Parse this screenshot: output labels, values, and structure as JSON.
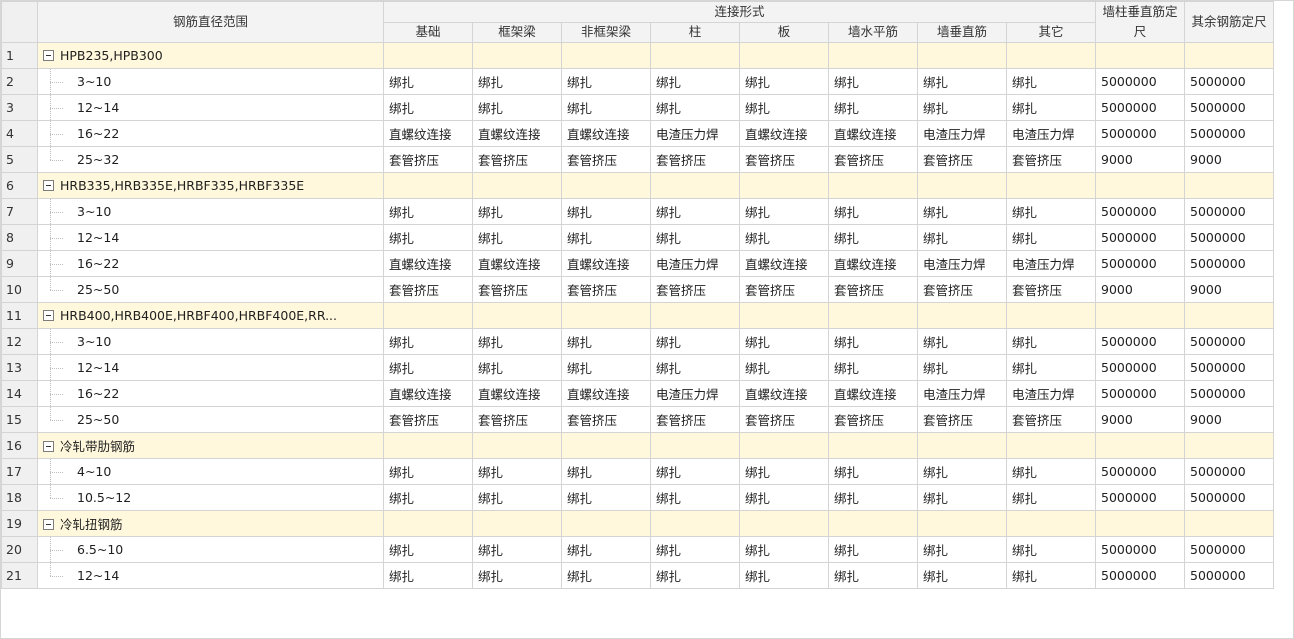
{
  "header": {
    "range_label": "钢筋直径范围",
    "group_label": "连接形式",
    "sub_cols": [
      "基础",
      "框架梁",
      "非框架梁",
      "柱",
      "板",
      "墙水平筋",
      "墙垂直筋",
      "其它"
    ],
    "wall_fixed_label": "墙柱垂直筋定尺",
    "other_fixed_label": "其余钢筋定尺"
  },
  "rows": [
    {
      "num": "1",
      "type": "group",
      "label": "HPB235,HPB300",
      "cells": [
        "",
        "",
        "",
        "",
        "",
        "",
        "",
        "",
        "",
        ""
      ]
    },
    {
      "num": "2",
      "type": "child",
      "label": "3~10",
      "cells": [
        "绑扎",
        "绑扎",
        "绑扎",
        "绑扎",
        "绑扎",
        "绑扎",
        "绑扎",
        "绑扎",
        "5000000",
        "5000000"
      ]
    },
    {
      "num": "3",
      "type": "child",
      "label": "12~14",
      "cells": [
        "绑扎",
        "绑扎",
        "绑扎",
        "绑扎",
        "绑扎",
        "绑扎",
        "绑扎",
        "绑扎",
        "5000000",
        "5000000"
      ]
    },
    {
      "num": "4",
      "type": "child",
      "label": "16~22",
      "cells": [
        "直螺纹连接",
        "直螺纹连接",
        "直螺纹连接",
        "电渣压力焊",
        "直螺纹连接",
        "直螺纹连接",
        "电渣压力焊",
        "电渣压力焊",
        "5000000",
        "5000000"
      ]
    },
    {
      "num": "5",
      "type": "child",
      "last": true,
      "label": "25~32",
      "cells": [
        "套管挤压",
        "套管挤压",
        "套管挤压",
        "套管挤压",
        "套管挤压",
        "套管挤压",
        "套管挤压",
        "套管挤压",
        "9000",
        "9000"
      ]
    },
    {
      "num": "6",
      "type": "group",
      "label": "HRB335,HRB335E,HRBF335,HRBF335E",
      "cells": [
        "",
        "",
        "",
        "",
        "",
        "",
        "",
        "",
        "",
        ""
      ]
    },
    {
      "num": "7",
      "type": "child",
      "label": "3~10",
      "cells": [
        "绑扎",
        "绑扎",
        "绑扎",
        "绑扎",
        "绑扎",
        "绑扎",
        "绑扎",
        "绑扎",
        "5000000",
        "5000000"
      ]
    },
    {
      "num": "8",
      "type": "child",
      "label": "12~14",
      "cells": [
        "绑扎",
        "绑扎",
        "绑扎",
        "绑扎",
        "绑扎",
        "绑扎",
        "绑扎",
        "绑扎",
        "5000000",
        "5000000"
      ]
    },
    {
      "num": "9",
      "type": "child",
      "label": "16~22",
      "cells": [
        "直螺纹连接",
        "直螺纹连接",
        "直螺纹连接",
        "电渣压力焊",
        "直螺纹连接",
        "直螺纹连接",
        "电渣压力焊",
        "电渣压力焊",
        "5000000",
        "5000000"
      ]
    },
    {
      "num": "10",
      "type": "child",
      "last": true,
      "label": "25~50",
      "cells": [
        "套管挤压",
        "套管挤压",
        "套管挤压",
        "套管挤压",
        "套管挤压",
        "套管挤压",
        "套管挤压",
        "套管挤压",
        "9000",
        "9000"
      ]
    },
    {
      "num": "11",
      "type": "group",
      "label": "HRB400,HRB400E,HRBF400,HRBF400E,RR...",
      "cells": [
        "",
        "",
        "",
        "",
        "",
        "",
        "",
        "",
        "",
        ""
      ]
    },
    {
      "num": "12",
      "type": "child",
      "label": "3~10",
      "cells": [
        "绑扎",
        "绑扎",
        "绑扎",
        "绑扎",
        "绑扎",
        "绑扎",
        "绑扎",
        "绑扎",
        "5000000",
        "5000000"
      ]
    },
    {
      "num": "13",
      "type": "child",
      "label": "12~14",
      "cells": [
        "绑扎",
        "绑扎",
        "绑扎",
        "绑扎",
        "绑扎",
        "绑扎",
        "绑扎",
        "绑扎",
        "5000000",
        "5000000"
      ]
    },
    {
      "num": "14",
      "type": "child",
      "label": "16~22",
      "cells": [
        "直螺纹连接",
        "直螺纹连接",
        "直螺纹连接",
        "电渣压力焊",
        "直螺纹连接",
        "直螺纹连接",
        "电渣压力焊",
        "电渣压力焊",
        "5000000",
        "5000000"
      ]
    },
    {
      "num": "15",
      "type": "child",
      "last": true,
      "label": "25~50",
      "cells": [
        "套管挤压",
        "套管挤压",
        "套管挤压",
        "套管挤压",
        "套管挤压",
        "套管挤压",
        "套管挤压",
        "套管挤压",
        "9000",
        "9000"
      ]
    },
    {
      "num": "16",
      "type": "group",
      "label": "冷轧带肋钢筋",
      "cells": [
        "",
        "",
        "",
        "",
        "",
        "",
        "",
        "",
        "",
        ""
      ]
    },
    {
      "num": "17",
      "type": "child",
      "label": "4~10",
      "cells": [
        "绑扎",
        "绑扎",
        "绑扎",
        "绑扎",
        "绑扎",
        "绑扎",
        "绑扎",
        "绑扎",
        "5000000",
        "5000000"
      ]
    },
    {
      "num": "18",
      "type": "child",
      "last": true,
      "label": "10.5~12",
      "cells": [
        "绑扎",
        "绑扎",
        "绑扎",
        "绑扎",
        "绑扎",
        "绑扎",
        "绑扎",
        "绑扎",
        "5000000",
        "5000000"
      ]
    },
    {
      "num": "19",
      "type": "group",
      "label": "冷轧扭钢筋",
      "cells": [
        "",
        "",
        "",
        "",
        "",
        "",
        "",
        "",
        "",
        ""
      ]
    },
    {
      "num": "20",
      "type": "child",
      "label": "6.5~10",
      "cells": [
        "绑扎",
        "绑扎",
        "绑扎",
        "绑扎",
        "绑扎",
        "绑扎",
        "绑扎",
        "绑扎",
        "5000000",
        "5000000"
      ]
    },
    {
      "num": "21",
      "type": "child",
      "last": true,
      "label": "12~14",
      "cells": [
        "绑扎",
        "绑扎",
        "绑扎",
        "绑扎",
        "绑扎",
        "绑扎",
        "绑扎",
        "绑扎",
        "5000000",
        "5000000"
      ]
    }
  ]
}
